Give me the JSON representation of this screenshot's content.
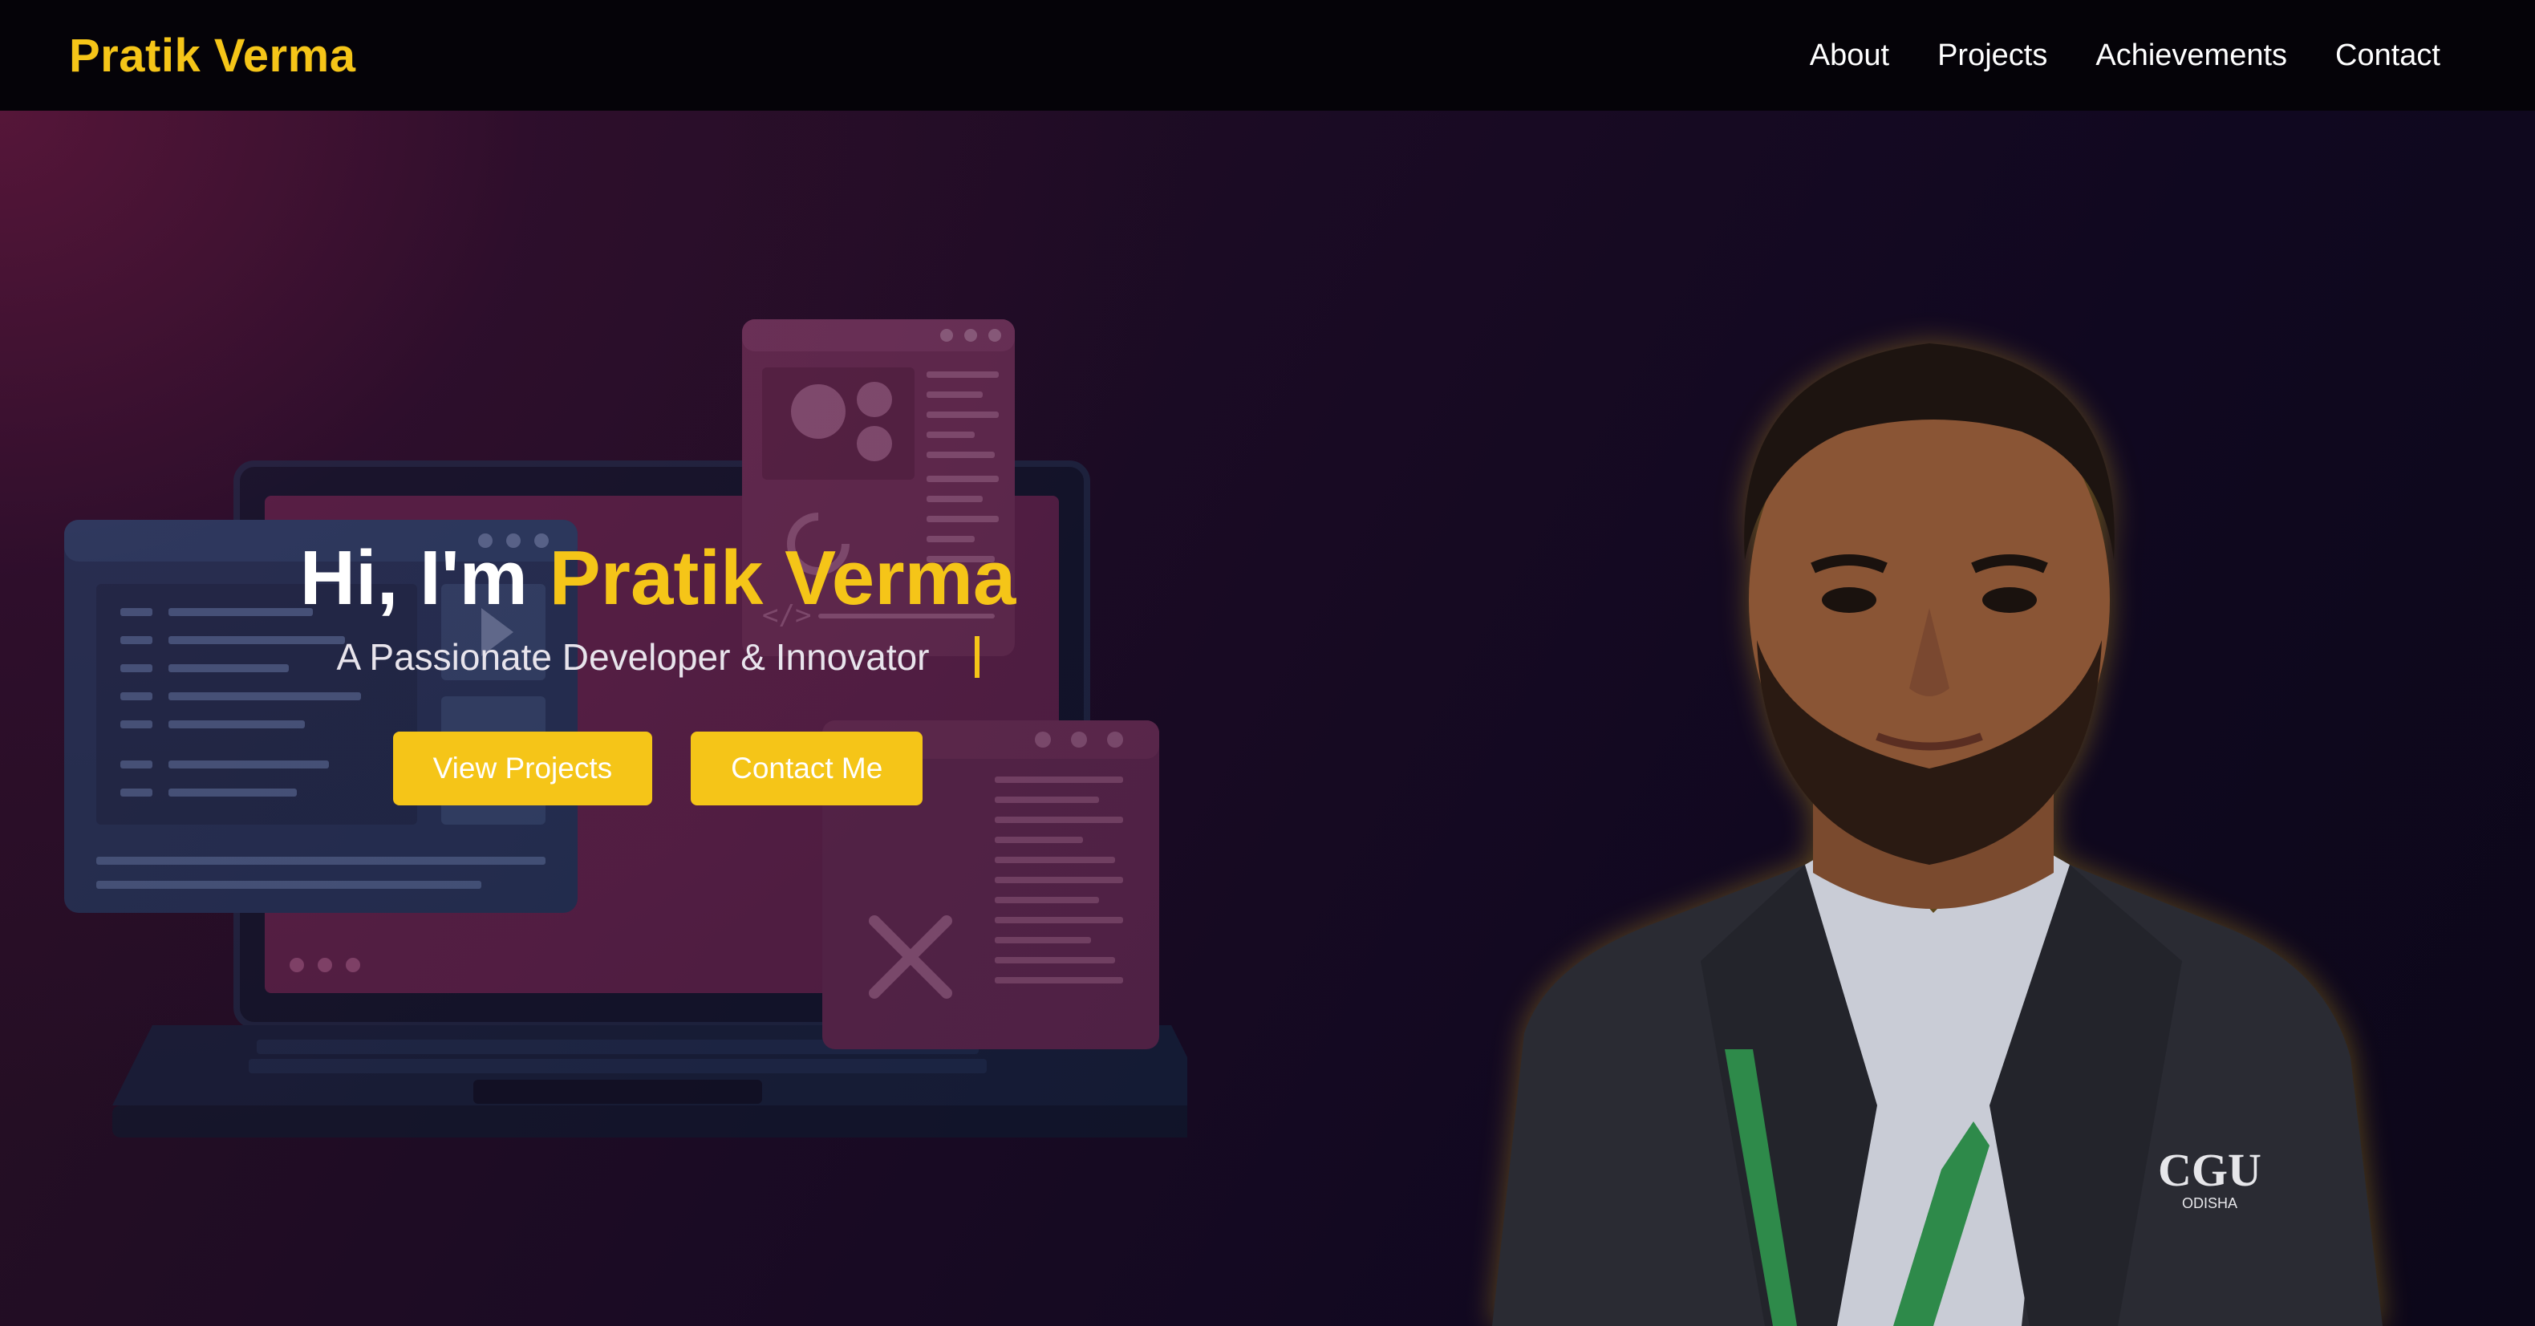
{
  "navbar": {
    "brand": "Pratik Verma",
    "links": [
      {
        "label": "About"
      },
      {
        "label": "Projects"
      },
      {
        "label": "Achievements"
      },
      {
        "label": "Contact"
      }
    ]
  },
  "hero": {
    "greeting": "Hi, I'm",
    "name": "Pratik Verma",
    "subtitle": "A Passionate Developer & Innovator",
    "buttons": {
      "view_projects": "View Projects",
      "contact_me": "Contact Me"
    },
    "photo_badge": "CGU",
    "photo_badge_sub": "ODISHA"
  },
  "colors": {
    "accent": "#f5c518",
    "navbar_bg": "#050308",
    "hero_bg": "#1b0b24"
  },
  "icons": [
    "gear-icon",
    "code-icon",
    "tools-icon",
    "play-icon",
    "users-icon",
    "loading-icon"
  ]
}
